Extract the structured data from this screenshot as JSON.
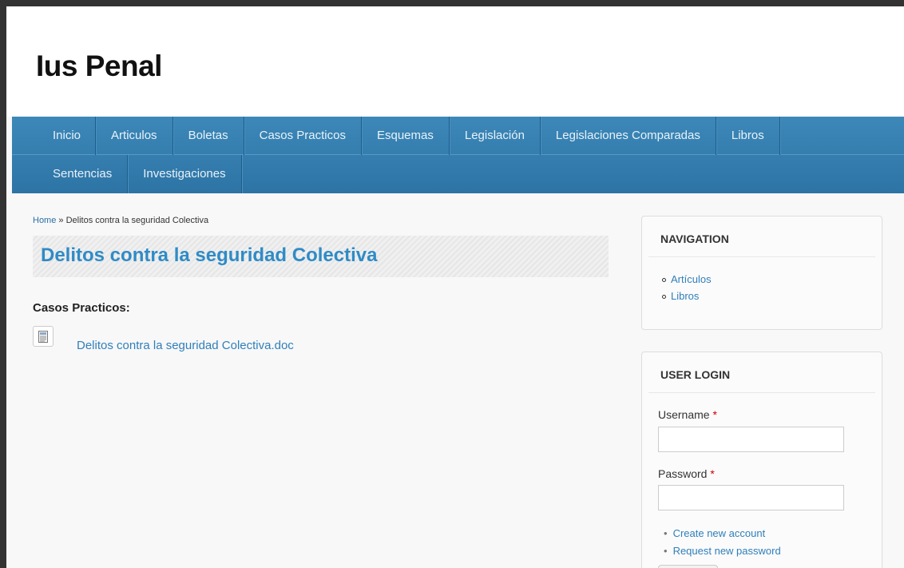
{
  "site": {
    "name": "Ius Penal"
  },
  "nav": {
    "row1": [
      "Inicio",
      "Articulos",
      "Boletas",
      "Casos Practicos",
      "Esquemas",
      "Legislación",
      "Legislaciones Comparadas",
      "Libros"
    ],
    "row2": [
      "Sentencias",
      "Investigaciones"
    ]
  },
  "breadcrumb": {
    "home": "Home",
    "separator": " » ",
    "current": "Delitos contra la seguridad Colectiva"
  },
  "page": {
    "title": "Delitos contra la seguridad Colectiva",
    "section_label": "Casos Practicos:",
    "attachment": "Delitos contra la seguridad Colectiva.doc"
  },
  "navigation_block": {
    "title": "NAVIGATION",
    "items": [
      "Artículos",
      "Libros"
    ]
  },
  "login_block": {
    "title": "USER LOGIN",
    "username_label": "Username",
    "password_label": "Password",
    "required_mark": "*",
    "links": [
      "Create new account",
      "Request new password"
    ]
  },
  "icons": {
    "attachment": "document-icon"
  },
  "colors": {
    "nav_bg": "#3582b4",
    "link": "#2f7fba",
    "title": "#2f8bc6"
  }
}
